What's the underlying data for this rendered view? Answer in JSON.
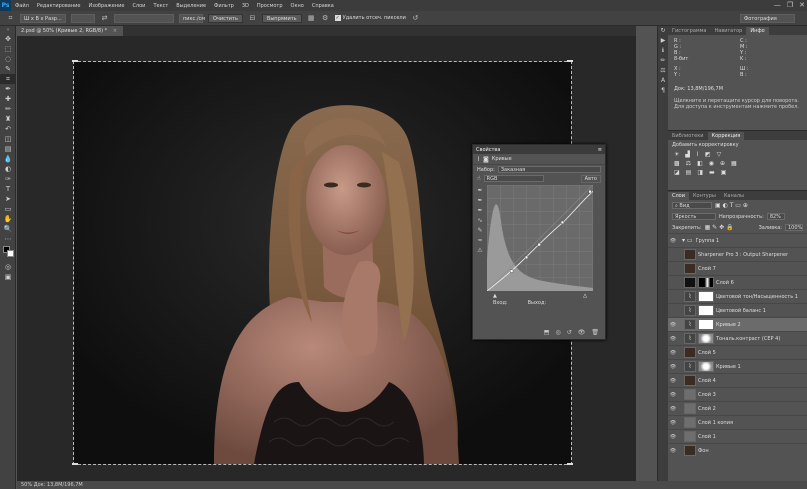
{
  "app": {
    "logo": "Ps"
  },
  "menu": [
    "Файл",
    "Редактирование",
    "Изображение",
    "Слои",
    "Текст",
    "Выделение",
    "Фильтр",
    "3D",
    "Просмотр",
    "Окно",
    "Справка"
  ],
  "window_controls": [
    "—",
    "❐",
    "✕"
  ],
  "options": {
    "ratio": "Ш x В x Разр...",
    "units": "пикс./см",
    "clear": "Очистить",
    "straighten": "Выпрямить",
    "delete_cropped": "Удалить отсеч. пиксели",
    "workspace": "Фотография"
  },
  "document": {
    "tab": "2.psd @ 50% (Кривые 2, RGB/8) *"
  },
  "status": {
    "text": "50%    Док: 13,8М/196,7М"
  },
  "info_panel": {
    "tabs": [
      "Гистограмма",
      "Навигатор",
      "Инфо"
    ],
    "r": "R :",
    "g": "G :",
    "b": "B :",
    "bit": "8-бит",
    "c": "C :",
    "m": "M :",
    "y": "Y :",
    "k": "K :",
    "x": "X :",
    "y2": "Y :",
    "w": "Ш :",
    "h": "В :",
    "doc": "Док: 13,8М/196,7М",
    "hint": "Щелкните и перетащите курсор для поворота. Для доступа к инструментам нажмите пробел."
  },
  "adjustments_panel": {
    "tabs": [
      "Библиотеки",
      "Коррекция"
    ],
    "title": "Добавить корректировку"
  },
  "layers_panel": {
    "tabs": [
      "Слои",
      "Контуры",
      "Каналы"
    ],
    "kind": "Вид",
    "blend": "Яркость",
    "opacity_label": "Непрозрачность:",
    "opacity": "82%",
    "lock_label": "Закрепить:",
    "fill_label": "Заливка:",
    "fill": "100%",
    "layers": [
      {
        "name": "Группа 1",
        "type": "group",
        "visible": true
      },
      {
        "name": "Sharpener Pro 3 : Output Sharpener",
        "type": "photo",
        "visible": false
      },
      {
        "name": "Слой 7",
        "type": "photo",
        "visible": false
      },
      {
        "name": "Слой 6",
        "type": "mask",
        "visible": false
      },
      {
        "name": "Цветовой тон/Насыщенность 1",
        "type": "adj",
        "visible": false
      },
      {
        "name": "Цветовой баланс 1",
        "type": "adj",
        "visible": false
      },
      {
        "name": "Кривые 2",
        "type": "adj",
        "visible": true,
        "selected": true
      },
      {
        "name": "Тональ.контраст (CEP 4)",
        "type": "adjmask",
        "visible": true
      },
      {
        "name": "Слой 5",
        "type": "photo",
        "visible": true
      },
      {
        "name": "Кривые 1",
        "type": "adjmask",
        "visible": true
      },
      {
        "name": "Слой 4",
        "type": "photo",
        "visible": true
      },
      {
        "name": "Слой 3",
        "type": "gray",
        "visible": true
      },
      {
        "name": "Слой 2",
        "type": "gray",
        "visible": true
      },
      {
        "name": "Слой 1 копия",
        "type": "gray",
        "visible": true
      },
      {
        "name": "Слой 1",
        "type": "gray",
        "visible": true
      },
      {
        "name": "Фон",
        "type": "photo",
        "visible": true
      }
    ]
  },
  "properties_panel": {
    "title": "Свойства",
    "adj_name": "Кривые",
    "preset_label": "Набор:",
    "preset": "Заказная",
    "channel": "RGB",
    "auto": "Авто",
    "input": "Вход:",
    "output": "Выход:"
  },
  "colors": {
    "accent": "#31a8ff",
    "bg": "#535353",
    "dark": "#282828",
    "panel_dark": "#3d3d3d"
  }
}
